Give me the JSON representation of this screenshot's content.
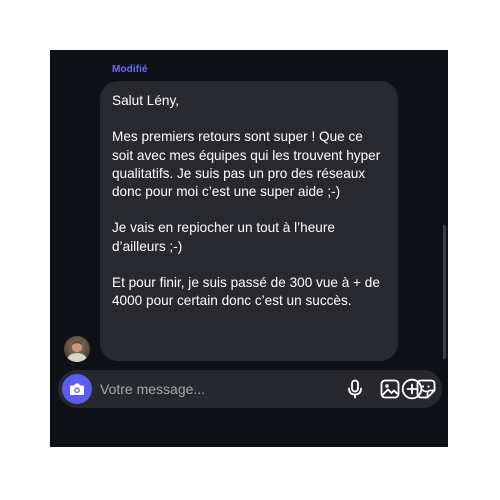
{
  "message": {
    "edited_label": "Modifié",
    "paragraphs": [
      "Salut Lény,",
      "Mes premiers retours sont super ! Que ce soit avec mes équipes qui les trouvent hyper qualitatifs. Je suis pas un pro des réseaux donc pour moi c’est une super aide ;-)",
      "Je vais en repiocher un tout à l’heure d’ailleurs ;-)",
      "Et pour finir, je suis passé de 300 vue à + de 4000 pour certain donc c’est un succès."
    ]
  },
  "composer": {
    "placeholder": "Votre message..."
  },
  "icons": {
    "camera": "camera-icon",
    "microphone": "microphone-icon",
    "image": "image-icon",
    "sticker": "sticker-icon",
    "add": "plus-circle-icon"
  },
  "colors": {
    "background": "#0e1116",
    "bubble": "#27292f",
    "accent": "#5b5cf0",
    "edited_label": "#6b6cf6"
  }
}
